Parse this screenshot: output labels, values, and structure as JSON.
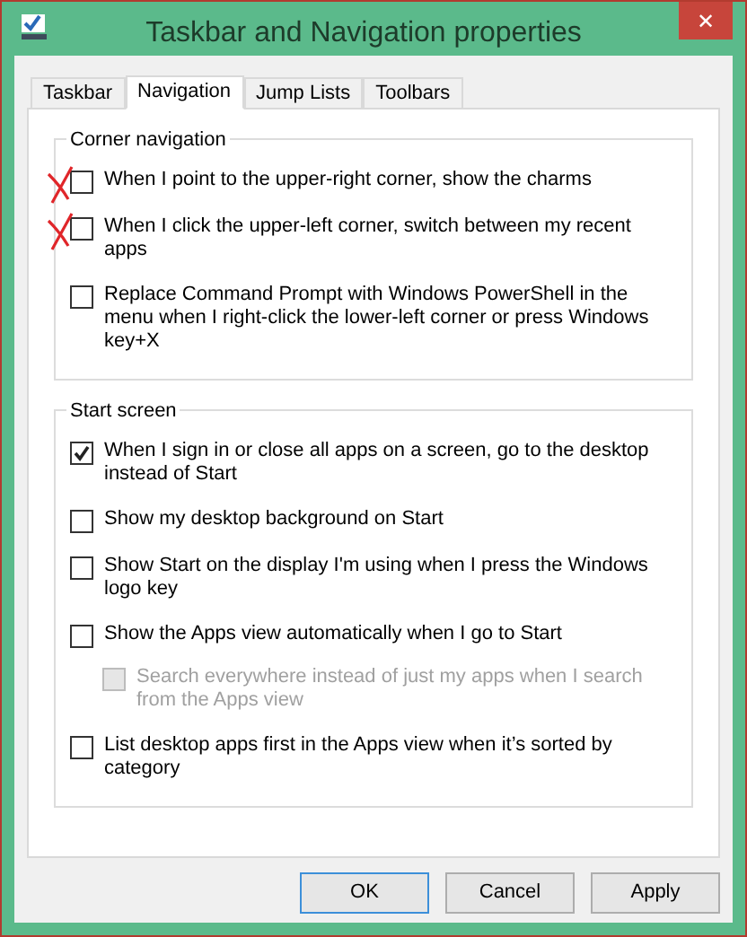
{
  "window": {
    "title": "Taskbar and Navigation properties",
    "close": "✕"
  },
  "tabs": [
    {
      "label": "Taskbar",
      "selected": false
    },
    {
      "label": "Navigation",
      "selected": true
    },
    {
      "label": "Jump Lists",
      "selected": false
    },
    {
      "label": "Toolbars",
      "selected": false
    }
  ],
  "groups": [
    {
      "title": "Corner navigation",
      "options": [
        {
          "label": "When I point to the upper-right corner, show the charms",
          "checked": false,
          "disabled": false,
          "crossed_out": true
        },
        {
          "label": "When I click the upper-left corner, switch between my recent apps",
          "checked": false,
          "disabled": false,
          "crossed_out": true
        },
        {
          "label": "Replace Command Prompt with Windows PowerShell in the menu when I right-click the lower-left corner or press Windows key+X",
          "checked": false,
          "disabled": false,
          "crossed_out": false
        }
      ]
    },
    {
      "title": "Start screen",
      "options": [
        {
          "label": "When I sign in or close all apps on a screen, go to the desktop instead of Start",
          "checked": true,
          "disabled": false,
          "crossed_out": false
        },
        {
          "label": "Show my desktop background on Start",
          "checked": false,
          "disabled": false,
          "crossed_out": false
        },
        {
          "label": "Show Start on the display I'm using when I press the Windows logo key",
          "checked": false,
          "disabled": false,
          "crossed_out": false
        },
        {
          "label": "Show the Apps view automatically when I go to Start",
          "checked": false,
          "disabled": false,
          "crossed_out": false,
          "children": [
            {
              "label": "Search everywhere instead of just my apps when I search from the Apps view",
              "checked": false,
              "disabled": true,
              "crossed_out": false
            }
          ]
        },
        {
          "label": "List desktop apps first in the Apps view when it’s sorted by category",
          "checked": false,
          "disabled": false,
          "crossed_out": false
        }
      ]
    }
  ],
  "buttons": [
    {
      "label": "OK",
      "selected": true
    },
    {
      "label": "Cancel",
      "selected": false
    },
    {
      "label": "Apply",
      "selected": false
    }
  ]
}
